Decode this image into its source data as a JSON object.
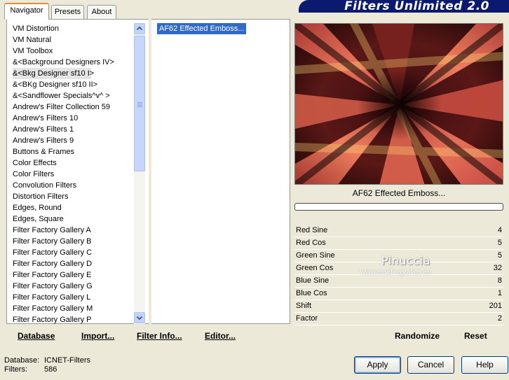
{
  "tabs": [
    {
      "label": "Navigator",
      "active": true
    },
    {
      "label": "Presets",
      "active": false
    },
    {
      "label": "About",
      "active": false
    }
  ],
  "window_title": "Filters Unlimited 2.0",
  "filters": [
    "VM Distortion",
    "VM Natural",
    "VM Toolbox",
    "&<Background Designers IV>",
    "&<Bkg Designer sf10 I>",
    "&<BKg Designer sf10 II>",
    "&<Sandflower Specials^v^ >",
    "Andrew's Filter Collection 59",
    "Andrew's Filters 10",
    "Andrew's Filters 1",
    "Andrew's Filters 9",
    "Buttons & Frames",
    "Color Effects",
    "Color Filters",
    "Convolution Filters",
    "Distortion Filters",
    "Edges, Round",
    "Edges, Square",
    "Filter Factory Gallery A",
    "Filter Factory Gallery B",
    "Filter Factory Gallery C",
    "Filter Factory Gallery D",
    "Filter Factory Gallery E",
    "Filter Factory Gallery G",
    "Filter Factory Gallery L",
    "Filter Factory Gallery M",
    "Filter Factory Gallery P"
  ],
  "selected_filter": "&<Bkg Designer sf10 I>",
  "effects": [
    "AF62 Effected Emboss..."
  ],
  "left_buttons": {
    "database": "Database",
    "import": "Import...",
    "filter_info": "Filter Info...",
    "editor": "Editor..."
  },
  "preview_label": "AF62 Effected Emboss...",
  "params": [
    {
      "name": "Red Sine",
      "value": "4"
    },
    {
      "name": "Red Cos",
      "value": "5"
    },
    {
      "name": "Green Sine",
      "value": "5"
    },
    {
      "name": "Green Cos",
      "value": "32"
    },
    {
      "name": "Blue Sine",
      "value": "8"
    },
    {
      "name": "Blue Cos",
      "value": "1"
    },
    {
      "name": "Shift",
      "value": "201"
    },
    {
      "name": "Factor",
      "value": "2"
    }
  ],
  "right_buttons": {
    "randomize": "Randomize",
    "reset": "Reset"
  },
  "watermark": {
    "name": "Pinuccia",
    "url": "www.maidiregrafica.eu"
  },
  "status": {
    "database_label": "Database:",
    "database_value": "ICNET-Filters",
    "filters_label": "Filters:",
    "filters_value": "586"
  },
  "dialog_buttons": {
    "apply": "Apply",
    "cancel": "Cancel",
    "help": "Help"
  },
  "colors": {
    "title_bar": "#0b1a6e",
    "selection": "#316ac5",
    "active_tab_accent": "#e68b2c"
  }
}
